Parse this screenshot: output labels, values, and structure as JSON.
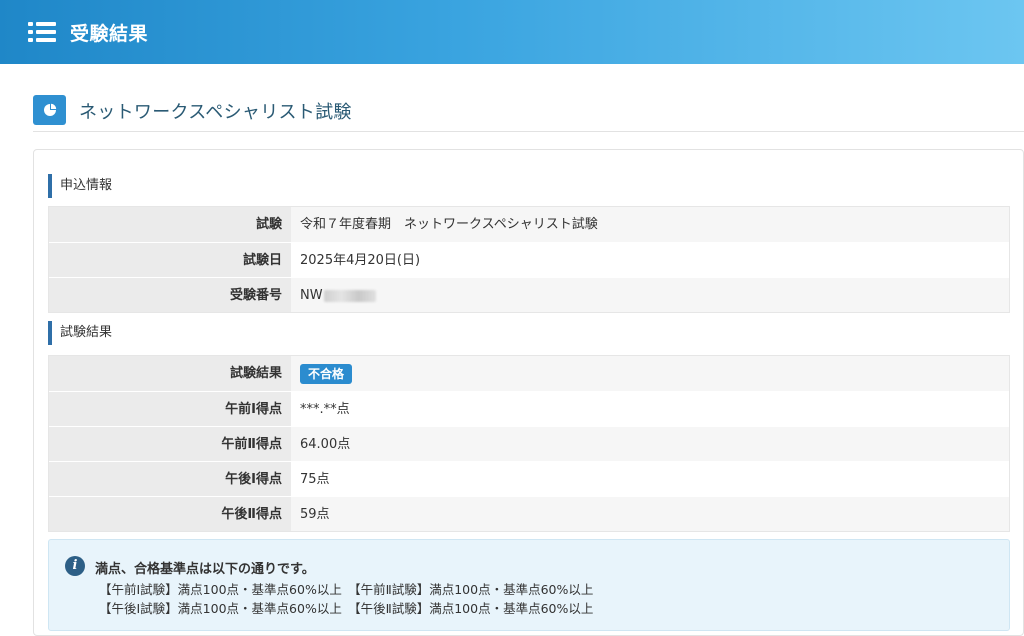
{
  "header": {
    "title": "受験結果",
    "menu_icon": "list-icon",
    "color": "#2a93d5"
  },
  "page": {
    "title": "ネットワークスペシャリスト試験",
    "icon": "pie-chart-icon"
  },
  "application": {
    "section_title": "申込情報",
    "rows": [
      {
        "label": "試験",
        "value": "令和７年度春期　ネットワークスペシャリスト試験"
      },
      {
        "label": "試験日",
        "value": "2025年4月20日(日)"
      },
      {
        "label": "受験番号",
        "value": "NW"
      }
    ]
  },
  "results": {
    "section_title": "試験結果",
    "result_label": "試験結果",
    "result_badge": "不合格",
    "badge_color": "#2b8ccf",
    "rows": [
      {
        "label": "午前Ⅰ得点",
        "value": "***.**点"
      },
      {
        "label": "午前Ⅱ得点",
        "value": "64.00点"
      },
      {
        "label": "午後Ⅰ得点",
        "value": "75点"
      },
      {
        "label": "午後Ⅱ得点",
        "value": "59点"
      }
    ]
  },
  "notice": {
    "icon": "info-icon",
    "title": "満点、合格基準点は以下の通りです。",
    "lines": [
      "【午前Ⅰ試験】満点100点・基準点60%以上　【午前Ⅱ試験】満点100点・基準点60%以上",
      "【午後Ⅰ試験】満点100点・基準点60%以上　【午後Ⅱ試験】満点100点・基準点60%以上"
    ]
  }
}
